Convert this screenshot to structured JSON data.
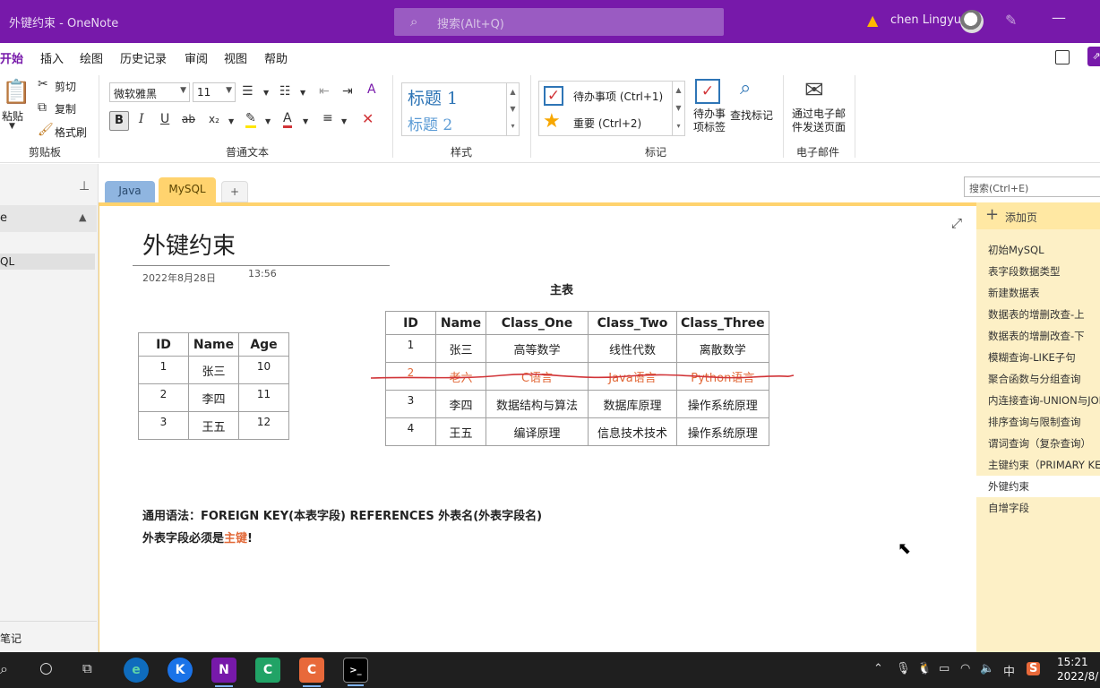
{
  "titlebar": {
    "app_title": "外键约束  -  OneNote",
    "search_placeholder": "搜索(Alt+Q)",
    "user_name": "chen Lingyu"
  },
  "menu": [
    "开始",
    "插入",
    "绘图",
    "历史记录",
    "审阅",
    "视图",
    "帮助"
  ],
  "ribbon": {
    "clipboard": {
      "paste": "粘贴",
      "cut": "剪切",
      "copy": "复制",
      "format_painter": "格式刷",
      "label": "剪贴板"
    },
    "basic_text": {
      "font": "微软雅黑",
      "size": "11",
      "bold": "B",
      "italic": "I",
      "underline": "U",
      "strike": "ab",
      "subscript": "x₂",
      "label": "普通文本"
    },
    "styles": {
      "heading1": "标题 1",
      "heading2": "标题 2",
      "label": "样式"
    },
    "tags": {
      "todo": "待办事项 (Ctrl+1)",
      "important": "重要 (Ctrl+2)",
      "todo_tag": "待办事项标签",
      "find_tags": "查找标记",
      "label": "标记"
    },
    "email": {
      "send": "通过电子邮件发送页面",
      "label": "电子邮件"
    }
  },
  "left_pane": {
    "notebook": "e",
    "section": "QL",
    "footer": "笔记"
  },
  "section_tabs": [
    "Java",
    "MySQL",
    "+"
  ],
  "page": {
    "title": "外键约束",
    "date": "2022年8月28日",
    "time": "13:56",
    "main_caption": "主表",
    "small_table": {
      "headers": [
        "ID",
        "Name",
        "Age"
      ],
      "rows": [
        [
          "1",
          "张三",
          "10"
        ],
        [
          "2",
          "李四",
          "11"
        ],
        [
          "3",
          "王五",
          "12"
        ]
      ]
    },
    "main_table": {
      "headers": [
        "ID",
        "Name",
        "Class_One",
        "Class_Two",
        "Class_Three"
      ],
      "rows": [
        [
          "1",
          "张三",
          "高等数学",
          "线性代数",
          "离散数学"
        ],
        [
          "2",
          "老六",
          "C语言",
          "Java语言",
          "Python语言"
        ],
        [
          "3",
          "李四",
          "数据结构与算法",
          "数据库原理",
          "操作系统原理"
        ],
        [
          "4",
          "王五",
          "编译原理",
          "信息技术技术",
          "操作系统原理"
        ]
      ]
    },
    "syntax": "通用语法：FOREIGN KEY(本表字段) REFERENCES 外表名(外表字段名)",
    "rule_prefix": "外表字段必须是",
    "rule_highlight": "主键",
    "rule_suffix": "!"
  },
  "page_list": {
    "search_placeholder": "搜索(Ctrl+E)",
    "add_page": "添加页",
    "items": [
      "初始MySQL",
      "表字段数据类型",
      "新建数据表",
      "数据表的增删改查-上",
      "数据表的增删改查-下",
      "模糊查询-LIKE子句",
      "聚合函数与分组查询",
      "内连接查询-UNION与JOIN",
      "排序查询与限制查询",
      "谓词查询（复杂查询）",
      "主键约束（PRIMARY KEY）",
      "外键约束",
      "自增字段"
    ],
    "selected_index": 11
  },
  "taskbar": {
    "apps": [
      "Edge",
      "K",
      "N",
      "C",
      "C",
      "cmd"
    ],
    "tray_ime": "中",
    "time": "15:21",
    "date": "2022/8/"
  },
  "colors": {
    "accent": "#7719aa",
    "section_tab": "#ffd36e",
    "strike_red": "#d13438",
    "highlight": "#e26a3a"
  }
}
